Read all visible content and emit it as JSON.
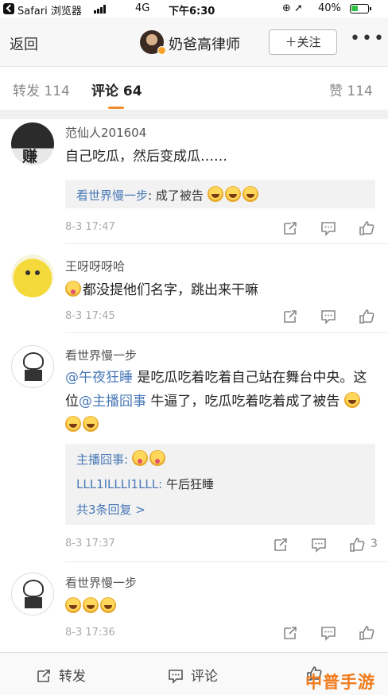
{
  "status_bar": {
    "carrier": "Safari 浏览器",
    "network": "4G",
    "time": "下午6:30",
    "battery": "40%",
    "battery_level": 0.4
  },
  "nav": {
    "back_label": "返回",
    "author_name": "奶爸高律师",
    "follow_label": "＋关注",
    "more_label": "•••"
  },
  "tabs": {
    "repost": "转发 114",
    "comments": "评论 64",
    "likes": "赞 114"
  },
  "comments": [
    {
      "username": "范仙人201604",
      "avatar_text": "赚",
      "text": "自己吃瓜，然后变成瓜……",
      "reply_author": "看世界慢一步",
      "reply_text": ": 成了被告",
      "time": "8-3 17:47"
    },
    {
      "username": "王呀呀呀哈",
      "text": "都没提他们名字，跳出来干嘛",
      "time": "8-3 17:45"
    },
    {
      "username": "看世界慢一步",
      "mention1": "@午夜狂睡",
      "text_part1": " 是吃瓜吃着吃着自己站在舞台中央。这位",
      "mention2": "@主播囧事",
      "text_part2": " 牛逼了，吃瓜吃着吃着成了被告",
      "replies": [
        {
          "author": "主播囧事:",
          "text": ""
        },
        {
          "author": "LLL1ILLLI1LLL:",
          "text": " 午后狂睡"
        }
      ],
      "more_replies": "共3条回复 >",
      "time": "8-3 17:37",
      "likes": "3"
    },
    {
      "username": "看世界慢一步",
      "time": "8-3 17:36"
    }
  ],
  "bottom_bar": {
    "repost": "转发",
    "comment": "评论"
  },
  "watermark": "中普手游网",
  "colors": {
    "accent": "#f08c2b",
    "link": "#4a79b7",
    "watermark": "#f07a1a"
  }
}
